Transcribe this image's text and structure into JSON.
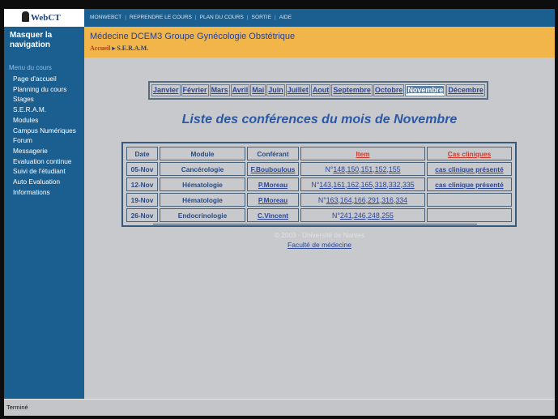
{
  "app": {
    "logo_text": "WebCT"
  },
  "sidebar": {
    "hide_nav": "Masquer la navigation",
    "menu_title": "Menu du cours",
    "items": [
      "Page d'accueil",
      "Planning du cours",
      "Stages",
      "S.E.R.A.M.",
      "Modules",
      "Campus Numériques",
      "Forum",
      "Messagerie",
      "Evaluation continue",
      "Suivi de l'étudiant",
      "Auto Evaluation",
      "Informations"
    ]
  },
  "topnav": {
    "items": [
      "MONWEBCT",
      "REPRENDRE LE COURS",
      "PLAN DU COURS",
      "SORTIE",
      "AIDE"
    ]
  },
  "header": {
    "course_title": "Médecine DCEM3 Groupe Gynécologie Obstétrique",
    "breadcrumb_home": "Accueil",
    "breadcrumb_sep": "▸",
    "breadcrumb_current": "S.E.R.A.M."
  },
  "months": {
    "items": [
      "Janvier",
      "Février",
      "Mars",
      "Avril",
      "Mai",
      "Juin",
      "Juillet",
      "Aout",
      "Septembre",
      "Octobre",
      "Novembre",
      "Décembre"
    ],
    "selected": "Novembre"
  },
  "main": {
    "title": "Liste des conférences du mois de Novembre"
  },
  "table": {
    "headers": [
      "Date",
      "Module",
      "Conférant",
      "Item",
      "Cas cliniques"
    ],
    "rows": [
      {
        "date": "05-Nov",
        "module": "Cancérologie",
        "speaker": "F.Bouboulous",
        "item_prefix": "N°",
        "items": "148,150,151,152,155",
        "case": "cas clinique présenté"
      },
      {
        "date": "12-Nov",
        "module": "Hématologie",
        "speaker": "P.Moreau",
        "item_prefix": "N°",
        "items": "143,161,162,165,318,332,335",
        "case": "cas clinique présenté"
      },
      {
        "date": "19-Nov",
        "module": "Hématologie",
        "speaker": "P.Moreau",
        "item_prefix": "N°",
        "items": "163,164,166,291,316,334",
        "case": ""
      },
      {
        "date": "26-Nov",
        "module": "Endocrinologie",
        "speaker": "C.Vincent",
        "item_prefix": "N°",
        "items": "241,246,248,255",
        "case": ""
      }
    ]
  },
  "footer": {
    "copyright": "© 2003 - Université de Nantes",
    "faculty_link": "Faculté de médecine"
  },
  "status": {
    "text": "Terminé"
  }
}
